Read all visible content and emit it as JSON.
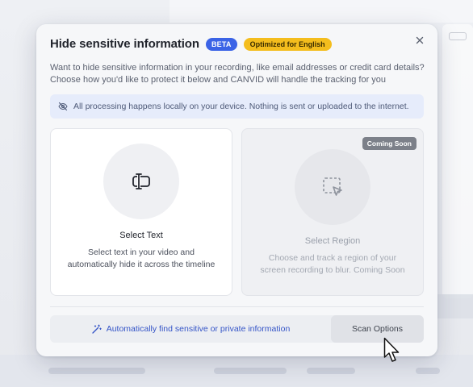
{
  "dialog": {
    "title": "Hide sensitive information",
    "badges": {
      "beta": "BETA",
      "optimized": "Optimized for English"
    },
    "description_line1": "Want to hide sensitive information in your recording, like email addresses or credit card details?",
    "description_line2": "Choose how you'd like to protect it below and CANVID will handle the tracking for you",
    "notice": "All processing happens locally on your device. Nothing is sent or uploaded to the internet.",
    "close_icon": "close-icon"
  },
  "options": [
    {
      "title": "Select Text",
      "description": "Select text in your video and automatically hide it across the timeline",
      "icon": "text-cursor-icon",
      "enabled": true
    },
    {
      "title": "Select Region",
      "description": "Choose and track a region of your screen recording to blur. Coming Soon",
      "icon": "region-select-icon",
      "badge": "Coming Soon",
      "enabled": false
    }
  ],
  "footer": {
    "auto_find_label": "Automatically find sensitive or private information",
    "auto_find_icon": "magic-wand-icon",
    "scan_options_label": "Scan Options"
  },
  "colors": {
    "accent": "#3b63e6",
    "beta_badge": "#3b63e6",
    "optimized_badge": "#f4bd1d",
    "notice_bg": "#e6ecfb",
    "link": "#3454c7"
  }
}
